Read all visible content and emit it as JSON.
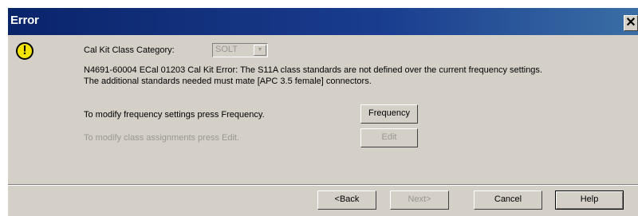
{
  "dialog": {
    "title": "Error",
    "close_glyph": "✕",
    "warning_glyph": "!",
    "category_label": "Cal Kit Class Category:",
    "category_value": "SOLT",
    "combo_arrow_glyph": "▼",
    "message_line1": "N4691-60004 ECal 01203 Cal Kit Error: The S11A class standards are not defined over the current frequency settings.",
    "message_line2": "The additional standards needed must mate [APC 3.5 female] connectors.",
    "freq_instruction": "To modify frequency settings press Frequency.",
    "freq_button": "Frequency",
    "edit_instruction": "To modify class assignments press Edit.",
    "edit_button": "Edit"
  },
  "footer": {
    "back_button": "<Back",
    "next_button": "Next>",
    "cancel_button": "Cancel",
    "help_button": "Help"
  },
  "colors": {
    "titlebar": "#0a246a",
    "dialog_bg": "#d4d0c8",
    "warning": "#f2e400",
    "disabled_text": "#9a978f"
  },
  "icons": [
    "warning-icon",
    "close-icon",
    "chevron-down-icon"
  ]
}
